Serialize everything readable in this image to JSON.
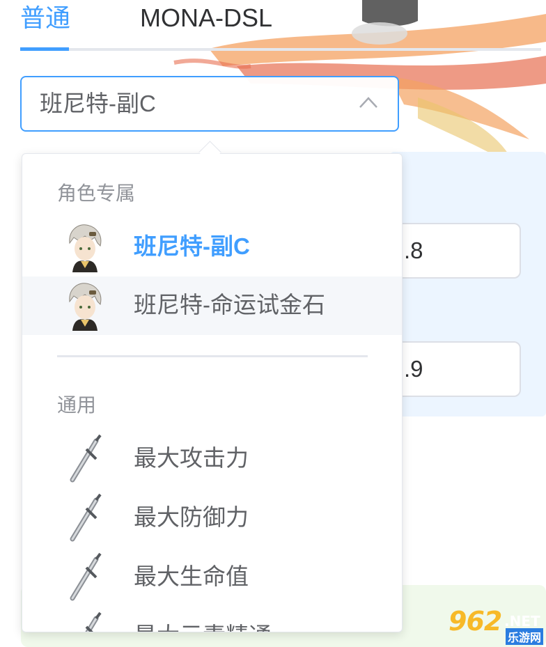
{
  "tabs": [
    {
      "label": "普通",
      "active": true
    },
    {
      "label": "MONA-DSL",
      "active": false
    }
  ],
  "select": {
    "value": "班尼特-副C",
    "expanded": true
  },
  "params": [
    {
      "value": ".8"
    },
    {
      "value": ".9"
    }
  ],
  "dropdown": {
    "groups": [
      {
        "label": "角色专属",
        "options": [
          {
            "label": "班尼特-副C",
            "icon": "bennett-avatar-icon",
            "selected": true
          },
          {
            "label": "班尼特-命运试金石",
            "icon": "bennett-avatar-icon",
            "hovered": true
          }
        ]
      },
      {
        "label": "通用",
        "options": [
          {
            "label": "最大攻击力",
            "icon": "sword-icon"
          },
          {
            "label": "最大防御力",
            "icon": "sword-icon"
          },
          {
            "label": "最大生命值",
            "icon": "sword-icon"
          },
          {
            "label": "最大元素精通",
            "icon": "sword-icon"
          }
        ]
      }
    ]
  },
  "watermark": {
    "main": "962",
    "net": ".NET",
    "sub": "乐游网"
  },
  "colors": {
    "accent": "#409eff",
    "text": "#606266",
    "muted": "#909399",
    "hover": "#f5f7fa"
  }
}
